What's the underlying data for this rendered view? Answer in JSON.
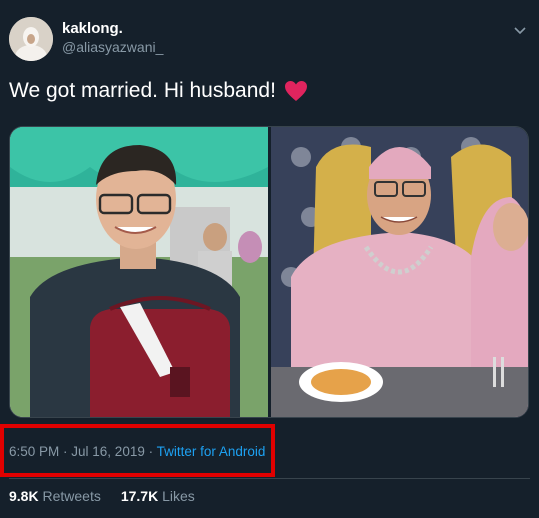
{
  "author": {
    "display_name": "kaklong.",
    "handle": "@aliasyazwani_"
  },
  "tweet": {
    "text": "We got married. Hi husband!",
    "emoji": "heart-emoji"
  },
  "meta": {
    "time": "6:50 PM",
    "separator1": " · ",
    "date": "Jul 16, 2019",
    "separator2": " · ",
    "source": "Twitter for Android"
  },
  "stats": {
    "retweets_count": "9.8K",
    "retweets_label": "Retweets",
    "likes_count": "17.7K",
    "likes_label": "Likes"
  },
  "colors": {
    "background": "#15202b",
    "muted_text": "#8899a6",
    "link": "#1da1f2",
    "highlight_box": "#e10000",
    "heart": "#e0245e"
  },
  "icons": {
    "menu": "chevron-down-icon",
    "heart": "heart-emoji"
  }
}
